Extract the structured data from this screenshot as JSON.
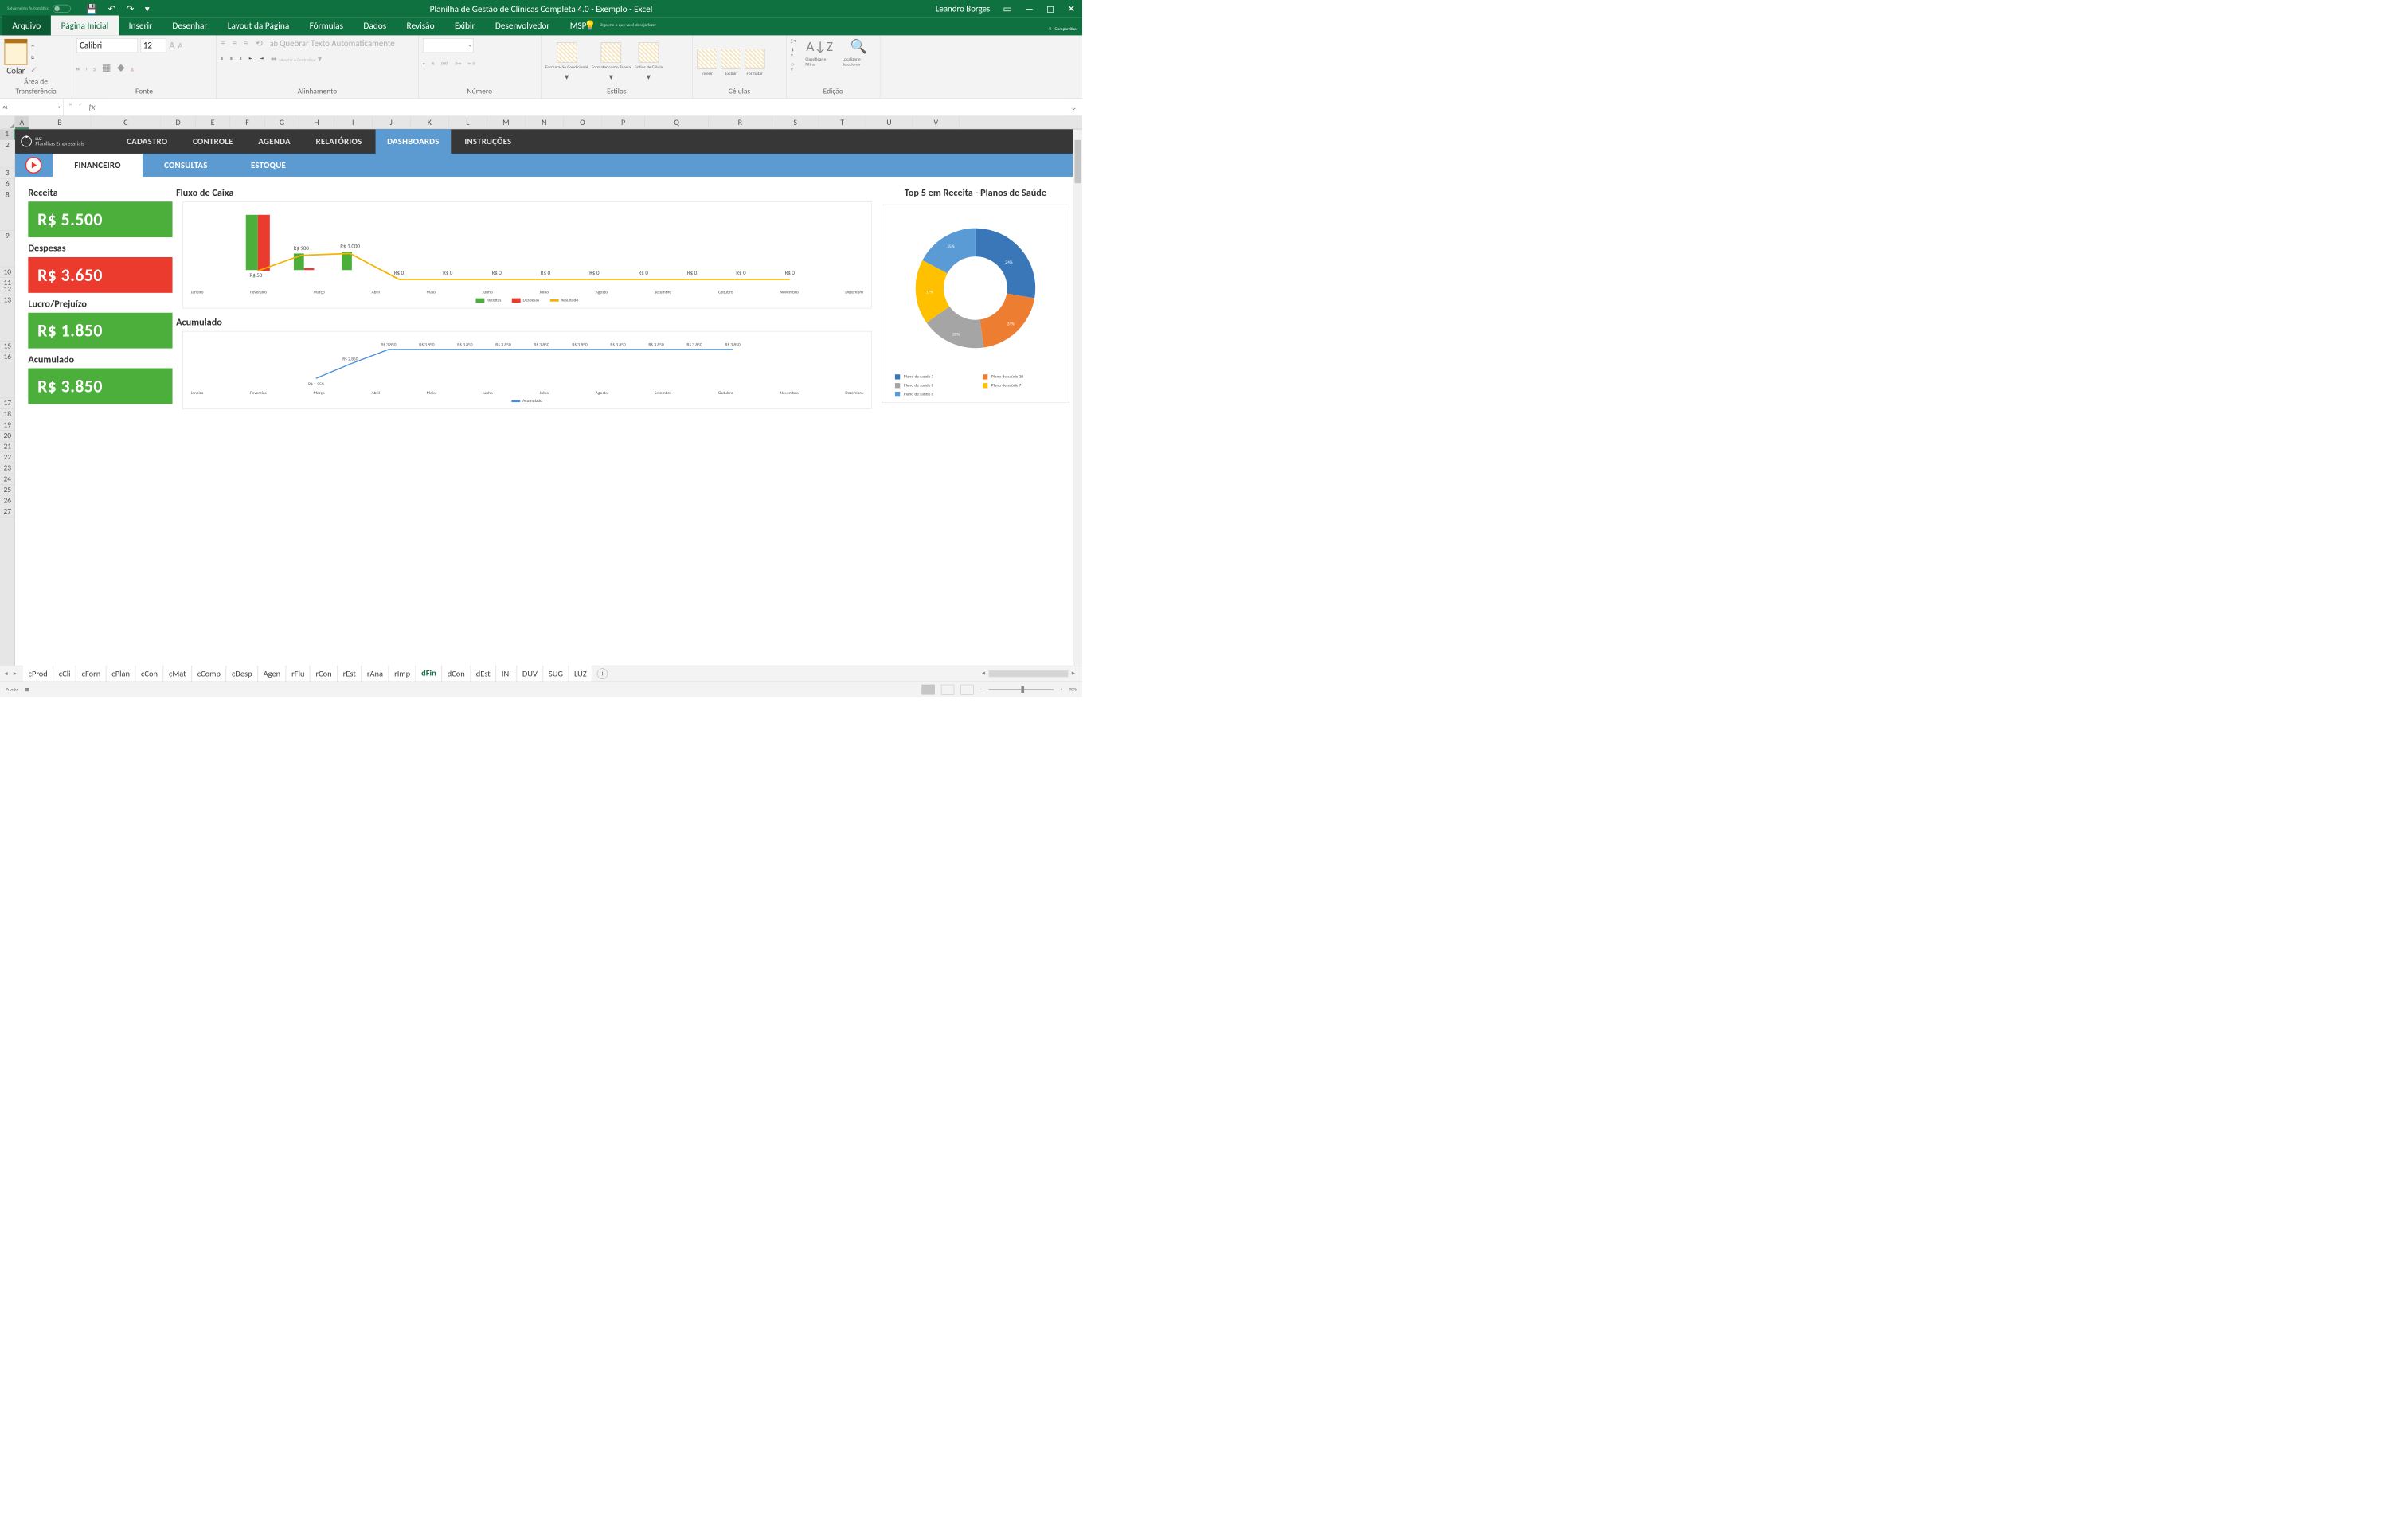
{
  "titlebar": {
    "autosave": "Salvamento Automático",
    "title": "Planilha de Gestão de Clínicas Completa 4.0 - Exemplo  -  Excel",
    "user": "Leandro Borges"
  },
  "ribbon": {
    "tabs": [
      "Arquivo",
      "Página Inicial",
      "Inserir",
      "Desenhar",
      "Layout da Página",
      "Fórmulas",
      "Dados",
      "Revisão",
      "Exibir",
      "Desenvolvedor",
      "MSP"
    ],
    "tellme": "Diga-me o que você deseja fazer",
    "share": "Compartilhar",
    "groups": {
      "clipboard": "Área de Transferência",
      "paste": "Colar",
      "font": "Fonte",
      "fontname": "Calibri",
      "fontsize": "12",
      "alignment": "Alinhamento",
      "wrap": "Quebrar Texto Automaticamente",
      "merge": "Mesclar e Centralizar",
      "number": "Número",
      "styles": "Estilos",
      "condformat": "Formatação Condicional",
      "tableformat": "Formatar como Tabela",
      "cellstyles": "Estilos de Célula",
      "cells": "Células",
      "insert": "Inserir",
      "delete": "Excluir",
      "format": "Formatar",
      "editing": "Edição",
      "sortfilter": "Classificar e Filtrar",
      "findselect": "Localizar e Selecionar"
    }
  },
  "namebox": "A1",
  "columns": [
    "A",
    "B",
    "C",
    "D",
    "E",
    "F",
    "G",
    "H",
    "I",
    "J",
    "K",
    "L",
    "M",
    "N",
    "O",
    "P",
    "Q",
    "R",
    "S",
    "T",
    "U",
    "V"
  ],
  "nav": {
    "brand": "LUZ",
    "brandsub": "Planilhas Empresariais",
    "items": [
      "CADASTRO",
      "CONTROLE",
      "AGENDA",
      "RELATÓRIOS",
      "DASHBOARDS",
      "INSTRUÇÕES"
    ],
    "subtabs": [
      "FINANCEIRO",
      "CONSULTAS",
      "ESTOQUE"
    ]
  },
  "kpis": {
    "receita": {
      "label": "Receita",
      "value": "R$ 5.500"
    },
    "despesas": {
      "label": "Despesas",
      "value": "R$ 3.650"
    },
    "lucro": {
      "label": "Lucro/Prejuízo",
      "value": "R$ 1.850"
    },
    "acumulado": {
      "label": "Acumulado",
      "value": "R$ 3.850"
    }
  },
  "months": [
    "Janeiro",
    "Fevereiro",
    "Março",
    "Abril",
    "Maio",
    "Junho",
    "Julho",
    "Agosto",
    "Setembro",
    "Outubro",
    "Novembro",
    "Dezembro"
  ],
  "fluxo": {
    "title": "Fluxo de Caixa",
    "legend": {
      "rec": "Receitas",
      "desp": "Despesas",
      "res": "Resultado"
    }
  },
  "acumchart": {
    "title": "Acumulado",
    "legend": "Acumulado"
  },
  "pie": {
    "title": "Top 5 em Receita - Planos de Saúde",
    "items": [
      "Plano de saúde 1",
      "Plano de saúde 10",
      "Plano de saúde 8",
      "Plano de saúde 7",
      "Plano de saúde 6"
    ]
  },
  "chart_data": [
    {
      "type": "bar",
      "title": "Fluxo de Caixa",
      "categories": [
        "Janeiro",
        "Fevereiro",
        "Março",
        "Abril",
        "Maio",
        "Junho",
        "Julho",
        "Agosto",
        "Setembro",
        "Outubro",
        "Novembro",
        "Dezembro"
      ],
      "series": [
        {
          "name": "Receitas",
          "values": [
            3500,
            1000,
            1000,
            0,
            0,
            0,
            0,
            0,
            0,
            0,
            0,
            0
          ]
        },
        {
          "name": "Despesas",
          "values": [
            3550,
            100,
            0,
            0,
            0,
            0,
            0,
            0,
            0,
            0,
            0,
            0
          ]
        },
        {
          "name": "Resultado",
          "values": [
            -50,
            900,
            1000,
            0,
            0,
            0,
            0,
            0,
            0,
            0,
            0,
            0
          ]
        }
      ],
      "data_labels_resultado": [
        "-R$ 50",
        "R$ 900",
        "R$ 1.000",
        "R$ 0",
        "R$ 0",
        "R$ 0",
        "R$ 0",
        "R$ 0",
        "R$ 0",
        "R$ 0",
        "R$ 0",
        "R$ 0"
      ]
    },
    {
      "type": "line",
      "title": "Acumulado",
      "categories": [
        "Janeiro",
        "Fevereiro",
        "Março",
        "Abril",
        "Maio",
        "Junho",
        "Julho",
        "Agosto",
        "Setembro",
        "Outubro",
        "Novembro",
        "Dezembro"
      ],
      "series": [
        {
          "name": "Acumulado",
          "values": [
            1950,
            2850,
            3850,
            3850,
            3850,
            3850,
            3850,
            3850,
            3850,
            3850,
            3850,
            3850
          ]
        }
      ],
      "data_labels": [
        "R$ 1.950",
        "R$ 2.850",
        "R$ 3.850",
        "R$ 3.850",
        "R$ 3.850",
        "R$ 3.850",
        "R$ 3.850",
        "R$ 3.850",
        "R$ 3.850",
        "R$ 3.850",
        "R$ 3.850",
        "R$ 3.850"
      ]
    },
    {
      "type": "pie",
      "title": "Top 5 em Receita - Planos de Saúde",
      "categories": [
        "Plano de saúde 1",
        "Plano de saúde 10",
        "Plano de saúde 8",
        "Plano de saúde 7",
        "Plano de saúde 6"
      ],
      "values": [
        24,
        24,
        20,
        17,
        15
      ],
      "value_labels": [
        "24%",
        "24%",
        "20%",
        "17%",
        "15%"
      ],
      "colors": [
        "#3a77b8",
        "#ed7d31",
        "#a5a5a5",
        "#ffc000",
        "#5b9bd5"
      ]
    }
  ],
  "sheettabs": [
    "cProd",
    "cCli",
    "cForn",
    "cPlan",
    "cCon",
    "cMat",
    "cComp",
    "cDesp",
    "Agen",
    "rFlu",
    "rCon",
    "rEst",
    "rAna",
    "rImp",
    "dFin",
    "dCon",
    "dEst",
    "INI",
    "DUV",
    "SUG",
    "LUZ"
  ],
  "status": {
    "ready": "Pronto",
    "zoom": "90%"
  }
}
